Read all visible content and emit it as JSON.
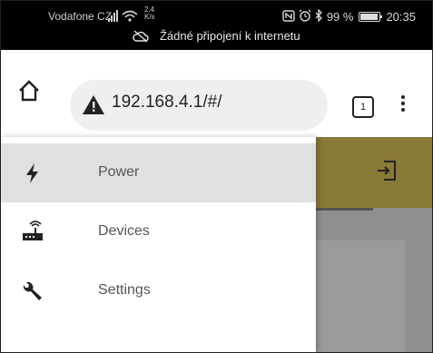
{
  "status_bar": {
    "carrier": "Vodafone CZ",
    "speed_value": "2,4",
    "speed_unit": "K/s",
    "battery_percent": "99 %",
    "time": "20:35"
  },
  "offline_banner": {
    "text": "Žádné připojení k internetu"
  },
  "browser": {
    "url": "192.168.4.1/#/",
    "tab_count": "1"
  },
  "drawer": {
    "items": [
      {
        "label": "Power",
        "icon": "lightning-icon",
        "active": true
      },
      {
        "label": "Devices",
        "icon": "router-icon",
        "active": false
      },
      {
        "label": "Settings",
        "icon": "wrench-icon",
        "active": false
      }
    ]
  },
  "colors": {
    "app_header": "#8a7a37",
    "overlay": "#8f8f8f",
    "drawer_active": "#e0e0e0"
  }
}
